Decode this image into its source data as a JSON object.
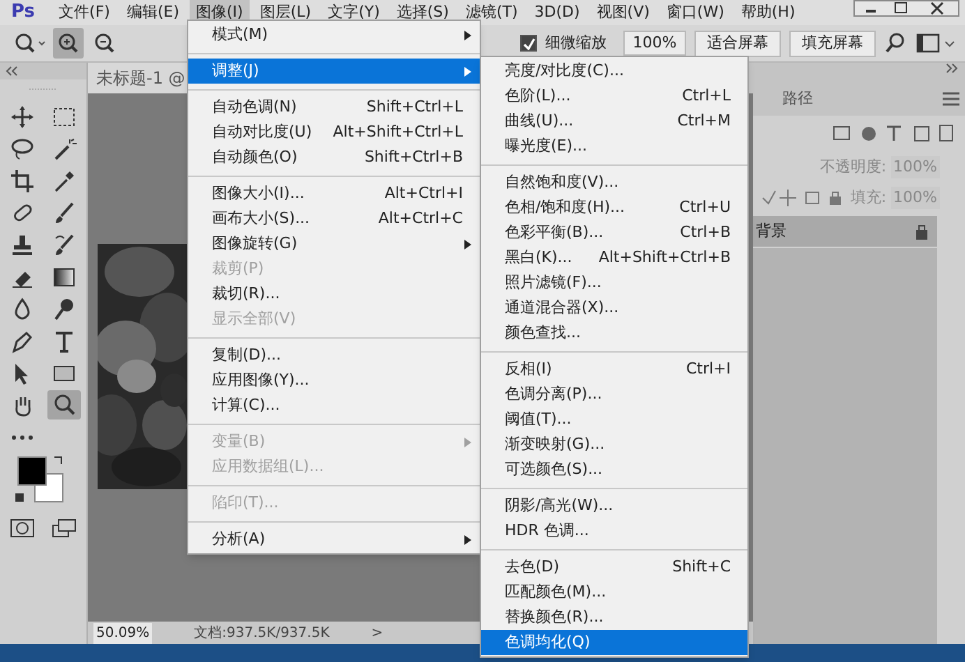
{
  "menu_bar": {
    "logo": "Ps",
    "items": [
      {
        "label": "文件(F)",
        "selected": false
      },
      {
        "label": "编辑(E)",
        "selected": false
      },
      {
        "label": "图像(I)",
        "selected": true
      },
      {
        "label": "图层(L)",
        "selected": false
      },
      {
        "label": "文字(Y)",
        "selected": false
      },
      {
        "label": "选择(S)",
        "selected": false
      },
      {
        "label": "滤镜(T)",
        "selected": false
      },
      {
        "label": "3D(D)",
        "selected": false
      },
      {
        "label": "视图(V)",
        "selected": false
      },
      {
        "label": "窗口(W)",
        "selected": false
      },
      {
        "label": "帮助(H)",
        "selected": false
      }
    ]
  },
  "options_bar": {
    "fine_zoom": {
      "label": "细微缩放",
      "checked": true
    },
    "zoom_value": "100%",
    "buttons": [
      "适合屏幕",
      "填充屏幕"
    ]
  },
  "toolbox": {
    "tools": [
      {
        "kind": "move",
        "selected": false
      },
      {
        "kind": "marquee",
        "selected": false
      },
      {
        "kind": "lasso",
        "selected": false
      },
      {
        "kind": "wand",
        "selected": false
      },
      {
        "kind": "crop",
        "selected": false
      },
      {
        "kind": "eyedropper",
        "selected": false
      },
      {
        "kind": "heal",
        "selected": false
      },
      {
        "kind": "brush",
        "selected": false
      },
      {
        "kind": "stamp",
        "selected": false
      },
      {
        "kind": "history",
        "selected": false
      },
      {
        "kind": "eraser",
        "selected": false
      },
      {
        "kind": "gradient",
        "selected": false
      },
      {
        "kind": "blur",
        "selected": false
      },
      {
        "kind": "dodge",
        "selected": false
      },
      {
        "kind": "pen",
        "selected": false
      },
      {
        "kind": "type",
        "selected": false
      },
      {
        "kind": "select",
        "selected": false
      },
      {
        "kind": "shape",
        "selected": false
      },
      {
        "kind": "hand",
        "selected": false
      },
      {
        "kind": "zoom",
        "selected": true
      },
      {
        "kind": "more",
        "selected": false
      }
    ]
  },
  "document": {
    "tab": "未标题-1 @"
  },
  "status_bar": {
    "zoom": "50.09%",
    "info": "文档:937.5K/937.5K",
    "arrow": ">"
  },
  "layers_panel": {
    "tab": "路径",
    "opacity_label": "不透明度:",
    "opacity": "100%",
    "fill_label": "填充:",
    "fill": "100%",
    "layers": [
      {
        "name": "背景",
        "locked": true
      }
    ]
  },
  "image_menu": {
    "items": [
      {
        "kind": "item",
        "label": "模式(M)",
        "submenu": true,
        "disabled": false,
        "selected": false
      },
      {
        "kind": "separator"
      },
      {
        "kind": "item",
        "label": "调整(J)",
        "submenu": true,
        "disabled": false,
        "selected": true
      },
      {
        "kind": "separator"
      },
      {
        "kind": "item",
        "label": "自动色调(N)",
        "shortcut": "Shift+Ctrl+L",
        "disabled": false,
        "selected": false
      },
      {
        "kind": "item",
        "label": "自动对比度(U)",
        "shortcut": "Alt+Shift+Ctrl+L",
        "disabled": false,
        "selected": false
      },
      {
        "kind": "item",
        "label": "自动颜色(O)",
        "shortcut": "Shift+Ctrl+B",
        "disabled": false,
        "selected": false
      },
      {
        "kind": "separator"
      },
      {
        "kind": "item",
        "label": "图像大小(I)...",
        "shortcut": "Alt+Ctrl+I",
        "disabled": false,
        "selected": false
      },
      {
        "kind": "item",
        "label": "画布大小(S)...",
        "shortcut": "Alt+Ctrl+C",
        "disabled": false,
        "selected": false
      },
      {
        "kind": "item",
        "label": "图像旋转(G)",
        "submenu": true,
        "disabled": false,
        "selected": false
      },
      {
        "kind": "item",
        "label": "裁剪(P)",
        "disabled": true,
        "selected": false
      },
      {
        "kind": "item",
        "label": "裁切(R)...",
        "disabled": false,
        "selected": false
      },
      {
        "kind": "item",
        "label": "显示全部(V)",
        "disabled": true,
        "selected": false
      },
      {
        "kind": "separator"
      },
      {
        "kind": "item",
        "label": "复制(D)...",
        "disabled": false,
        "selected": false
      },
      {
        "kind": "item",
        "label": "应用图像(Y)...",
        "disabled": false,
        "selected": false
      },
      {
        "kind": "item",
        "label": "计算(C)...",
        "disabled": false,
        "selected": false
      },
      {
        "kind": "separator"
      },
      {
        "kind": "item",
        "label": "变量(B)",
        "submenu": true,
        "disabled": true,
        "selected": false
      },
      {
        "kind": "item",
        "label": "应用数据组(L)...",
        "disabled": true,
        "selected": false
      },
      {
        "kind": "separator"
      },
      {
        "kind": "item",
        "label": "陷印(T)...",
        "disabled": true,
        "selected": false
      },
      {
        "kind": "separator"
      },
      {
        "kind": "item",
        "label": "分析(A)",
        "submenu": true,
        "disabled": false,
        "selected": false
      }
    ]
  },
  "adjust_menu": {
    "items": [
      {
        "kind": "item",
        "label": "亮度/对比度(C)...",
        "selected": false
      },
      {
        "kind": "item",
        "label": "色阶(L)...",
        "shortcut": "Ctrl+L",
        "selected": false
      },
      {
        "kind": "item",
        "label": "曲线(U)...",
        "shortcut": "Ctrl+M",
        "selected": false
      },
      {
        "kind": "item",
        "label": "曝光度(E)...",
        "selected": false
      },
      {
        "kind": "separator"
      },
      {
        "kind": "item",
        "label": "自然饱和度(V)...",
        "selected": false
      },
      {
        "kind": "item",
        "label": "色相/饱和度(H)...",
        "shortcut": "Ctrl+U",
        "selected": false
      },
      {
        "kind": "item",
        "label": "色彩平衡(B)...",
        "shortcut": "Ctrl+B",
        "selected": false
      },
      {
        "kind": "item",
        "label": "黑白(K)...",
        "shortcut": "Alt+Shift+Ctrl+B",
        "selected": false
      },
      {
        "kind": "item",
        "label": "照片滤镜(F)...",
        "selected": false
      },
      {
        "kind": "item",
        "label": "通道混合器(X)...",
        "selected": false
      },
      {
        "kind": "item",
        "label": "颜色查找...",
        "selected": false
      },
      {
        "kind": "separator"
      },
      {
        "kind": "item",
        "label": "反相(I)",
        "shortcut": "Ctrl+I",
        "selected": false
      },
      {
        "kind": "item",
        "label": "色调分离(P)...",
        "selected": false
      },
      {
        "kind": "item",
        "label": "阈值(T)...",
        "selected": false
      },
      {
        "kind": "item",
        "label": "渐变映射(G)...",
        "selected": false
      },
      {
        "kind": "item",
        "label": "可选颜色(S)...",
        "selected": false
      },
      {
        "kind": "separator"
      },
      {
        "kind": "item",
        "label": "阴影/高光(W)...",
        "selected": false
      },
      {
        "kind": "item",
        "label": "HDR 色调...",
        "selected": false
      },
      {
        "kind": "separator"
      },
      {
        "kind": "item",
        "label": "去色(D)",
        "shortcut": "Shift+C",
        "selected": false
      },
      {
        "kind": "item",
        "label": "匹配颜色(M)...",
        "selected": false
      },
      {
        "kind": "item",
        "label": "替换颜色(R)...",
        "selected": false
      },
      {
        "kind": "item",
        "label": "色调均化(Q)",
        "selected": true
      }
    ]
  }
}
